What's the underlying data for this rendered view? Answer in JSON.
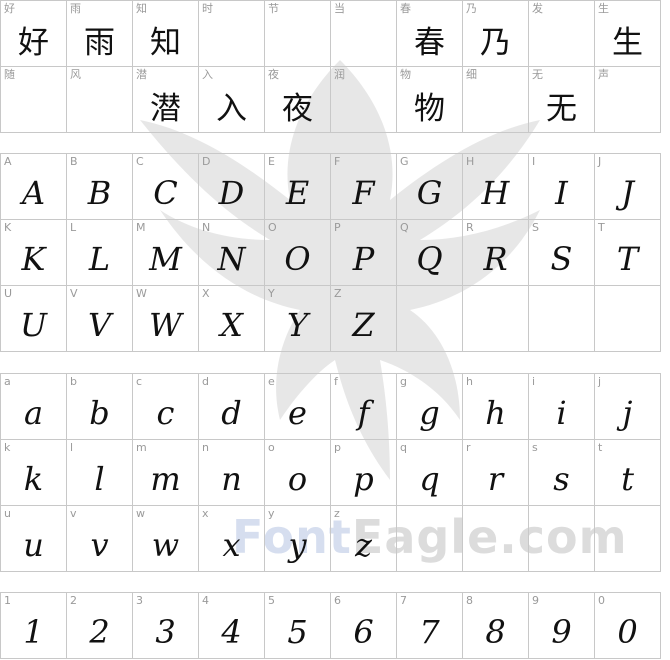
{
  "watermark": {
    "brand_part1": "Font",
    "brand_part2": "Eagle.com"
  },
  "sections": [
    {
      "cells": [
        {
          "label": "好",
          "glyph": "好"
        },
        {
          "label": "雨",
          "glyph": "雨"
        },
        {
          "label": "知",
          "glyph": "知"
        },
        {
          "label": "时",
          "glyph": ""
        },
        {
          "label": "节",
          "glyph": ""
        },
        {
          "label": "当",
          "glyph": ""
        },
        {
          "label": "春",
          "glyph": "春"
        },
        {
          "label": "乃",
          "glyph": "乃"
        },
        {
          "label": "发",
          "glyph": ""
        },
        {
          "label": "生",
          "glyph": "生"
        },
        {
          "label": "随",
          "glyph": ""
        },
        {
          "label": "风",
          "glyph": ""
        },
        {
          "label": "潜",
          "glyph": "潜"
        },
        {
          "label": "入",
          "glyph": "入"
        },
        {
          "label": "夜",
          "glyph": "夜"
        },
        {
          "label": "润",
          "glyph": ""
        },
        {
          "label": "物",
          "glyph": "物"
        },
        {
          "label": "细",
          "glyph": ""
        },
        {
          "label": "无",
          "glyph": "无"
        },
        {
          "label": "声",
          "glyph": ""
        }
      ]
    },
    {
      "cells": [
        {
          "label": "A",
          "glyph": "A"
        },
        {
          "label": "B",
          "glyph": "B"
        },
        {
          "label": "C",
          "glyph": "C"
        },
        {
          "label": "D",
          "glyph": "D"
        },
        {
          "label": "E",
          "glyph": "E"
        },
        {
          "label": "F",
          "glyph": "F"
        },
        {
          "label": "G",
          "glyph": "G"
        },
        {
          "label": "H",
          "glyph": "H"
        },
        {
          "label": "I",
          "glyph": "I"
        },
        {
          "label": "J",
          "glyph": "J"
        },
        {
          "label": "K",
          "glyph": "K"
        },
        {
          "label": "L",
          "glyph": "L"
        },
        {
          "label": "M",
          "glyph": "M"
        },
        {
          "label": "N",
          "glyph": "N"
        },
        {
          "label": "O",
          "glyph": "O"
        },
        {
          "label": "P",
          "glyph": "P"
        },
        {
          "label": "Q",
          "glyph": "Q"
        },
        {
          "label": "R",
          "glyph": "R"
        },
        {
          "label": "S",
          "glyph": "S"
        },
        {
          "label": "T",
          "glyph": "T"
        },
        {
          "label": "U",
          "glyph": "U"
        },
        {
          "label": "V",
          "glyph": "V"
        },
        {
          "label": "W",
          "glyph": "W"
        },
        {
          "label": "X",
          "glyph": "X"
        },
        {
          "label": "Y",
          "glyph": "Y"
        },
        {
          "label": "Z",
          "glyph": "Z"
        },
        {
          "label": "",
          "glyph": ""
        },
        {
          "label": "",
          "glyph": ""
        },
        {
          "label": "",
          "glyph": ""
        },
        {
          "label": "",
          "glyph": ""
        }
      ]
    },
    {
      "cells": [
        {
          "label": "a",
          "glyph": "a"
        },
        {
          "label": "b",
          "glyph": "b"
        },
        {
          "label": "c",
          "glyph": "c"
        },
        {
          "label": "d",
          "glyph": "d"
        },
        {
          "label": "e",
          "glyph": "e"
        },
        {
          "label": "f",
          "glyph": "f"
        },
        {
          "label": "g",
          "glyph": "g"
        },
        {
          "label": "h",
          "glyph": "h"
        },
        {
          "label": "i",
          "glyph": "i"
        },
        {
          "label": "j",
          "glyph": "j"
        },
        {
          "label": "k",
          "glyph": "k"
        },
        {
          "label": "l",
          "glyph": "l"
        },
        {
          "label": "m",
          "glyph": "m"
        },
        {
          "label": "n",
          "glyph": "n"
        },
        {
          "label": "o",
          "glyph": "o"
        },
        {
          "label": "p",
          "glyph": "p"
        },
        {
          "label": "q",
          "glyph": "q"
        },
        {
          "label": "r",
          "glyph": "r"
        },
        {
          "label": "s",
          "glyph": "s"
        },
        {
          "label": "t",
          "glyph": "t"
        },
        {
          "label": "u",
          "glyph": "u"
        },
        {
          "label": "v",
          "glyph": "v"
        },
        {
          "label": "w",
          "glyph": "w"
        },
        {
          "label": "x",
          "glyph": "x"
        },
        {
          "label": "y",
          "glyph": "y"
        },
        {
          "label": "z",
          "glyph": "z"
        },
        {
          "label": "",
          "glyph": ""
        },
        {
          "label": "",
          "glyph": ""
        },
        {
          "label": "",
          "glyph": ""
        },
        {
          "label": "",
          "glyph": ""
        }
      ]
    },
    {
      "cells": [
        {
          "label": "1",
          "glyph": "1"
        },
        {
          "label": "2",
          "glyph": "2"
        },
        {
          "label": "3",
          "glyph": "3"
        },
        {
          "label": "4",
          "glyph": "4"
        },
        {
          "label": "5",
          "glyph": "5"
        },
        {
          "label": "6",
          "glyph": "6"
        },
        {
          "label": "7",
          "glyph": "7"
        },
        {
          "label": "8",
          "glyph": "8"
        },
        {
          "label": "9",
          "glyph": "9"
        },
        {
          "label": "0",
          "glyph": "0"
        }
      ]
    }
  ]
}
